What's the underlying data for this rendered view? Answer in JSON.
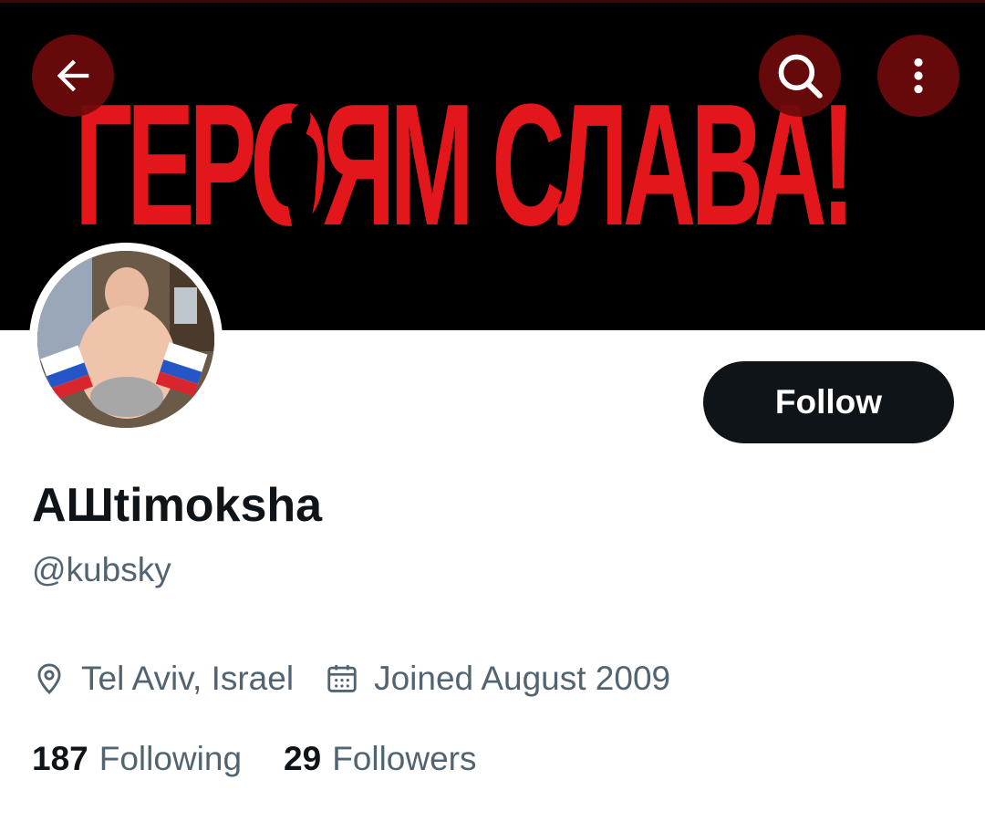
{
  "banner": {
    "text": "ГЕРОЯМ СЛАВА!",
    "background": "#000000",
    "text_color": "#e3161b"
  },
  "header": {
    "back_icon": "arrow-left-icon",
    "search_icon": "search-icon",
    "more_icon": "more-vertical-icon",
    "button_bg": "#6e0a0c"
  },
  "profile": {
    "display_name": "AШtimoksha",
    "handle": "@kubsky",
    "follow_label": "Follow",
    "location_icon": "location-pin-icon",
    "location": "Tel Aviv, Israel",
    "calendar_icon": "calendar-icon",
    "joined": "Joined August 2009",
    "following_count": "187",
    "following_label": "Following",
    "followers_count": "29",
    "followers_label": "Followers"
  },
  "colors": {
    "primary_text": "#0f1419",
    "secondary_text": "#536471",
    "follow_bg": "#0f1419"
  }
}
